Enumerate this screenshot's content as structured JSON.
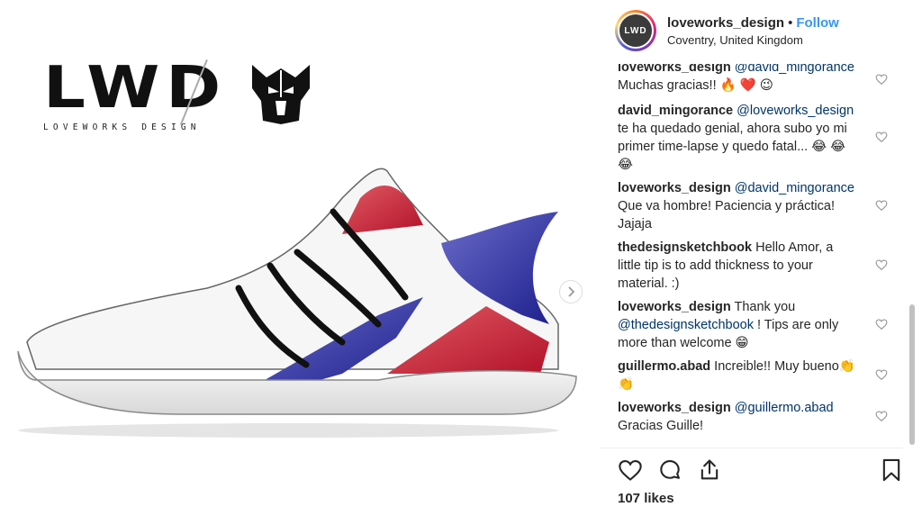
{
  "post_image": {
    "logo_letters": "LWD",
    "logo_subtitle": "LOVEWORKS DESIGN",
    "next_icon": "chevron-right-icon"
  },
  "header": {
    "username": "loveworks_design",
    "separator": "•",
    "follow_label": "Follow",
    "location": "Coventry, United Kingdom",
    "avatar_text": "LWD"
  },
  "comments": [
    {
      "user": "loveworks_design",
      "mention": "@david_mingorance",
      "text": "Muchas gracias!! 🔥 ❤️ 😉"
    },
    {
      "user": "david_mingorance",
      "mention": "@loveworks_design",
      "text": "te ha quedado genial, ahora subo yo mi primer time-lapse y quedo fatal... 😂 😂 😂"
    },
    {
      "user": "loveworks_design",
      "mention": "@david_mingorance",
      "text": "Que va hombre! Paciencia y práctica! Jajaja"
    },
    {
      "user": "thedesignsketchbook",
      "mention": "",
      "text": "Hello Amor, a little tip is to add thickness to your material. :)"
    },
    {
      "user": "loveworks_design",
      "mention": "@thedesignsketchbook",
      "text": "Thank you",
      "text_after": "! Tips are only more than welcome 😁"
    },
    {
      "user": "guillermo.abad",
      "mention": "",
      "text": "Increible!! Muy bueno👏 👏"
    },
    {
      "user": "loveworks_design",
      "mention": "@guillermo.abad",
      "text": "Gracias Guille!"
    }
  ],
  "actions": {
    "like_icon": "heart-icon",
    "comment_icon": "comment-icon",
    "share_icon": "share-icon",
    "save_icon": "bookmark-icon"
  },
  "likes_text": "107 likes"
}
